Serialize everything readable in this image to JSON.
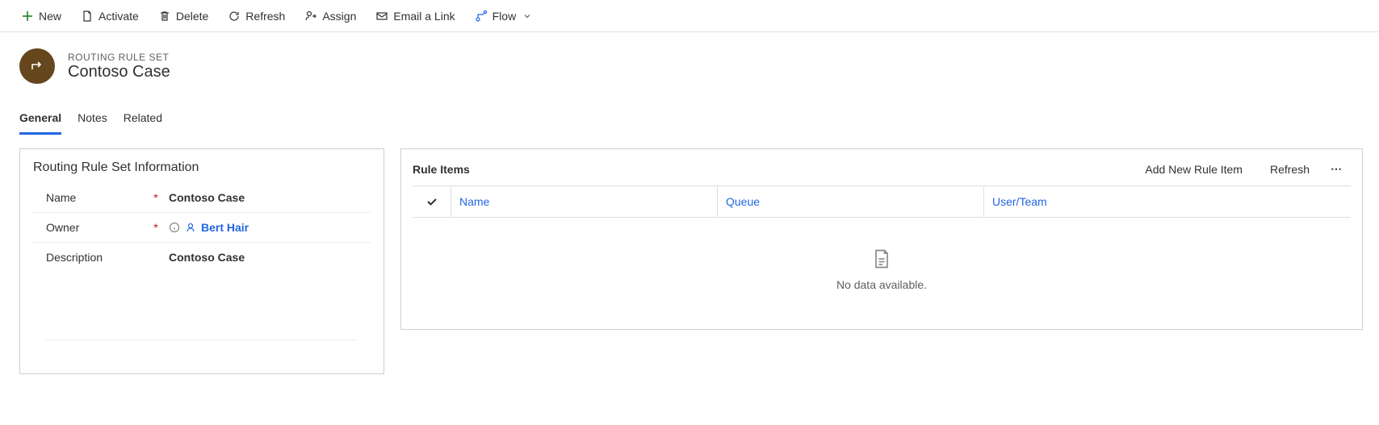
{
  "toolbar": {
    "new": "New",
    "activate": "Activate",
    "delete": "Delete",
    "refresh": "Refresh",
    "assign": "Assign",
    "email_link": "Email a Link",
    "flow": "Flow"
  },
  "header": {
    "subtitle": "ROUTING RULE SET",
    "title": "Contoso Case"
  },
  "tabs": {
    "general": "General",
    "notes": "Notes",
    "related": "Related"
  },
  "form": {
    "section_title": "Routing Rule Set Information",
    "name_label": "Name",
    "name_value": "Contoso Case",
    "owner_label": "Owner",
    "owner_value": "Bert Hair",
    "description_label": "Description",
    "description_value": "Contoso Case",
    "required_mark": "*"
  },
  "rule_items": {
    "title": "Rule Items",
    "add": "Add New Rule Item",
    "refresh": "Refresh",
    "columns": {
      "name": "Name",
      "queue": "Queue",
      "user_team": "User/Team"
    },
    "empty": "No data available."
  }
}
